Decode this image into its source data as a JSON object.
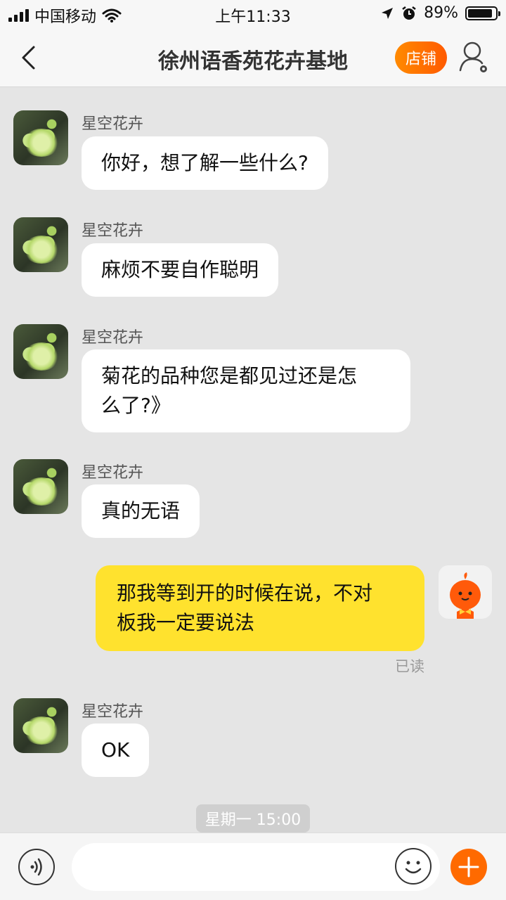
{
  "status_bar": {
    "carrier": "中国移动",
    "time": "上午11:33",
    "battery": "89%",
    "battery_level": 0.89
  },
  "nav": {
    "title": "徐州语香苑花卉基地",
    "store_label": "店铺",
    "icons": {
      "back": "chevron-left-icon",
      "profile": "user-settings-icon"
    }
  },
  "messages": [
    {
      "sender": "星空花卉",
      "text": "你好，想了解一些什么?"
    },
    {
      "sender": "星空花卉",
      "text": "麻烦不要自作聪明"
    },
    {
      "sender": "星空花卉",
      "text": "菊花的品种您是都见过还是怎\n么了?》"
    },
    {
      "sender": "星空花卉",
      "text": "真的无语"
    },
    {
      "mine": true,
      "text": "那我等到开的时候在说，不对\n板我一定要说法",
      "status": "已读"
    },
    {
      "sender": "星空花卉",
      "text": "OK"
    }
  ],
  "timestamp": "星期一 15:00",
  "input_bar": {
    "input_value": "",
    "icons": {
      "voice": "voice-icon",
      "emoji": "smiley-icon",
      "more": "plus-icon"
    }
  },
  "colors": {
    "accent": "#ff6a00",
    "my_bubble": "#ffe22e",
    "background": "#e5e5e5"
  }
}
